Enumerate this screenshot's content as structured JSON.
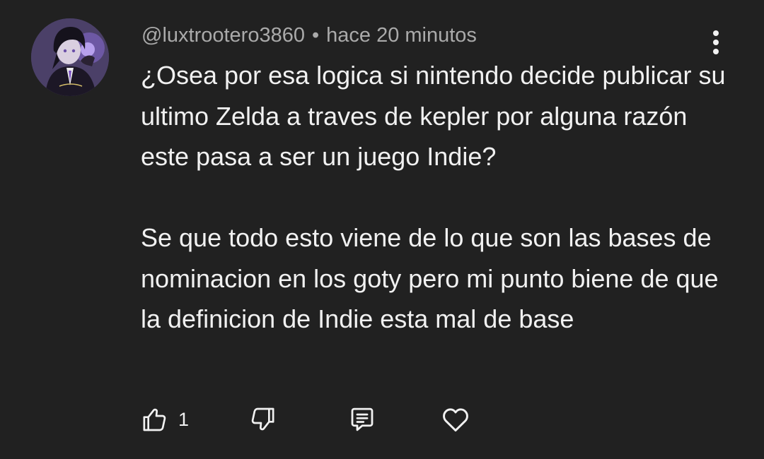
{
  "comment": {
    "author": "@luxtrootero3860",
    "separator": "•",
    "time": "hace 20 minutos",
    "paragraphs": [
      "¿Osea por esa logica si nintendo decide publicar su ultimo Zelda a traves de kepler por alguna razón este pasa a ser un juego Indie?",
      "Se que todo esto viene de lo que son las bases de nominacion en los goty pero mi punto biene de que la definicion de Indie esta mal de base"
    ]
  },
  "actions": {
    "like_count": "1",
    "icons": [
      "thumbs-up-icon",
      "thumbs-down-icon",
      "reply-icon",
      "heart-icon",
      "more-vertical-icon"
    ]
  },
  "colors": {
    "background": "#212121",
    "text_primary": "#f1f1f1",
    "text_secondary": "#aaaaaa"
  }
}
